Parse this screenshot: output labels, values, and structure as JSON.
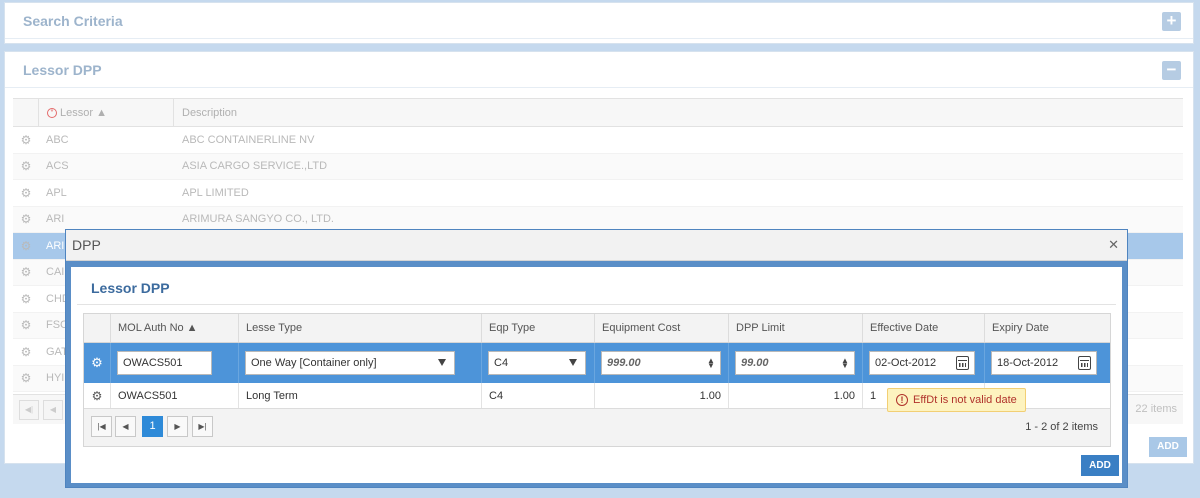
{
  "search_panel": {
    "title": "Search Criteria",
    "toggle": "+"
  },
  "lessor_panel": {
    "title": "Lessor DPP",
    "toggle": "−",
    "columns": {
      "lessor": "Lessor ▲",
      "description": "Description"
    },
    "rows": [
      {
        "lessor": "ABC",
        "description": "ABC CONTAINERLINE NV"
      },
      {
        "lessor": "ACS",
        "description": "ASIA CARGO SERVICE.,LTD"
      },
      {
        "lessor": "APL",
        "description": "APL LIMITED"
      },
      {
        "lessor": "ARI",
        "description": "ARIMURA SANGYO CO., LTD."
      },
      {
        "lessor": "ARI",
        "description": ""
      },
      {
        "lessor": "CAI",
        "description": ""
      },
      {
        "lessor": "CHD",
        "description": ""
      },
      {
        "lessor": "FSC",
        "description": ""
      },
      {
        "lessor": "GAT",
        "description": ""
      },
      {
        "lessor": "HYI",
        "description": ""
      }
    ],
    "pager_items": "22 items",
    "add_label": "ADD"
  },
  "modal": {
    "title": "DPP",
    "close": "✕",
    "heading": "Lessor DPP",
    "columns": {
      "mol_auth_no": "MOL Auth No ▲",
      "lesse_type": "Lesse Type",
      "eqp_type": "Eqp Type",
      "equipment_cost": "Equipment Cost",
      "dpp_limit": "DPP Limit",
      "effective_date": "Effective Date",
      "expiry_date": "Expiry Date"
    },
    "edit_row": {
      "mol_auth_no": "OWACS501",
      "lesse_type": "One Way [Container only]",
      "eqp_type": "C4",
      "equipment_cost": "999.00",
      "dpp_limit": "99.00",
      "effective_date": "02-Oct-2012",
      "expiry_date": "18-Oct-2012"
    },
    "data_row": {
      "mol_auth_no": "OWACS501",
      "lesse_type": "Long Term",
      "eqp_type": "C4",
      "equipment_cost": "1.00",
      "dpp_limit": "1.00",
      "effective_date_partial": "1"
    },
    "tooltip": "EffDt is not valid date",
    "pager": {
      "page": "1",
      "items": "1 - 2 of 2 items"
    },
    "add_label": "ADD"
  }
}
